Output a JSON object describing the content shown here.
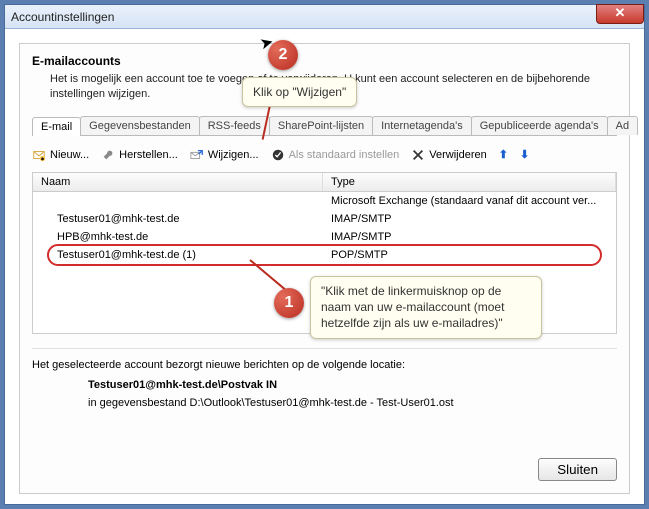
{
  "window": {
    "title": "Accountinstellingen"
  },
  "header": {
    "title": "E-mailaccounts",
    "desc": "Het is mogelijk een account toe te voegen of te verwijderen. U kunt een account selecteren en de bijbehorende instellingen wijzigen."
  },
  "tabs": {
    "items": [
      {
        "label": "E-mail",
        "active": true
      },
      {
        "label": "Gegevensbestanden"
      },
      {
        "label": "RSS-feeds"
      },
      {
        "label": "SharePoint-lijsten"
      },
      {
        "label": "Internetagenda's"
      },
      {
        "label": "Gepubliceerde agenda's"
      },
      {
        "label": "Ad"
      }
    ]
  },
  "toolbar": {
    "new": "Nieuw...",
    "repair": "Herstellen...",
    "change": "Wijzigen...",
    "default": "Als standaard instellen",
    "remove": "Verwijderen"
  },
  "list": {
    "headers": {
      "name": "Naam",
      "type": "Type"
    },
    "rows": [
      {
        "name": "",
        "type": "Microsoft Exchange (standaard vanaf dit account ver..."
      },
      {
        "name": "Testuser01@mhk-test.de",
        "type": "IMAP/SMTP"
      },
      {
        "name": "HPB@mhk-test.de",
        "type": "IMAP/SMTP"
      },
      {
        "name": "Testuser01@mhk-test.de (1)",
        "type": "POP/SMTP"
      }
    ]
  },
  "footer": {
    "intro": "Het geselecteerde account bezorgt nieuwe berichten op de volgende locatie:",
    "loc1": "Testuser01@mhk-test.de\\Postvak IN",
    "loc2": "in gegevensbestand D:\\Outlook\\Testuser01@mhk-test.de - Test-User01.ost"
  },
  "buttons": {
    "close": "Sluiten"
  },
  "callouts": {
    "c1": {
      "num": "1",
      "text": "\"Klik met de linkermuisknop op de naam van uw e-mailaccount (moet hetzelfde zijn als uw e-mailadres)\""
    },
    "c2": {
      "num": "2",
      "text": "Klik op \"Wijzigen\""
    }
  }
}
